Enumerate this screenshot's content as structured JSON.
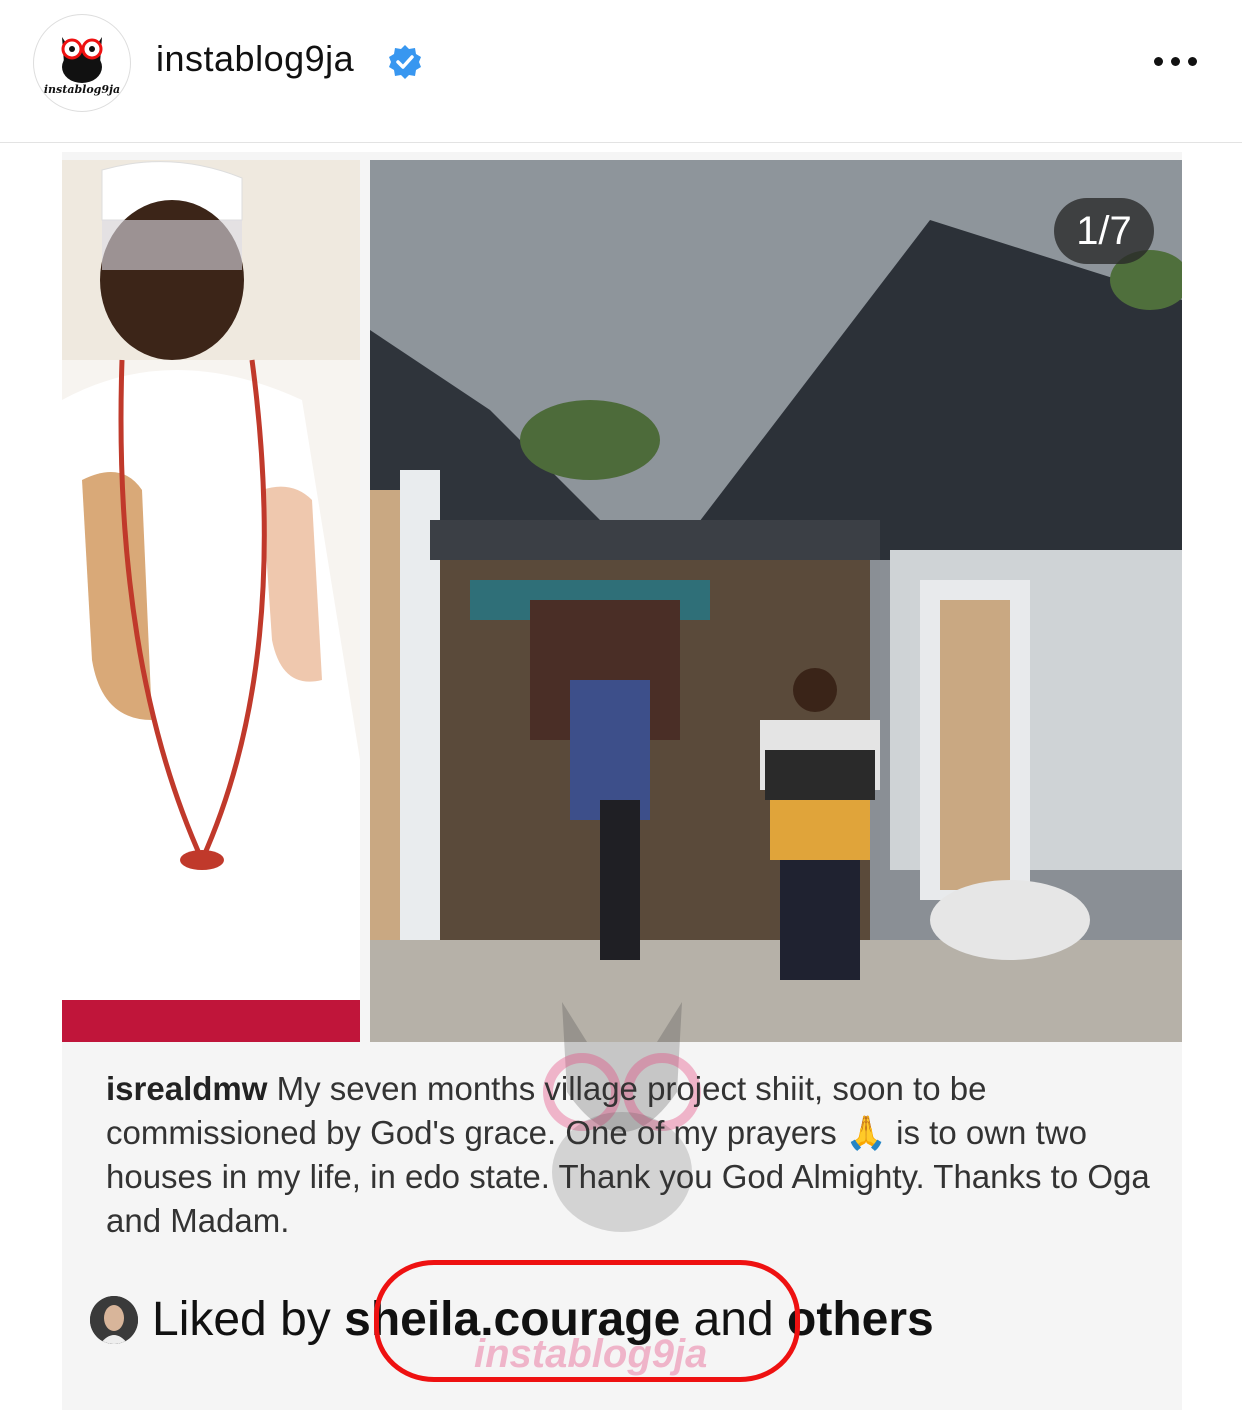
{
  "header": {
    "avatar_text": "instablog9ja",
    "username": "instablog9ja",
    "verified_icon": "verified-badge-icon",
    "more_icon": "more-options-icon"
  },
  "post": {
    "counter": "1/7",
    "caption_user": "isrealdmw",
    "caption_text": " My seven months village project shiit, soon to be commissioned by God's grace. One of my prayers 🙏 is to own two houses in my life, in edo state. Thank you God Almighty. Thanks to Oga and Madam.",
    "watermark": "instablog9ja",
    "likes_prefix": "Liked by ",
    "likes_user": "sheila.courage",
    "likes_middle": " and ",
    "likes_suffix": "others"
  },
  "colors": {
    "verified": "#3897f0",
    "highlight": "#e11111"
  }
}
